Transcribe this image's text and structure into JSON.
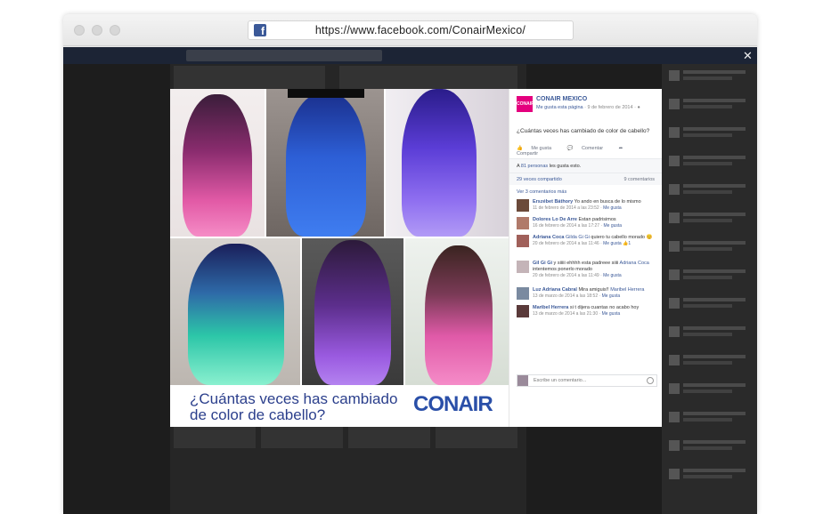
{
  "browser": {
    "url": "https://www.facebook.com/ConairMexico/",
    "favicon": "f"
  },
  "photo": {
    "caption_line1": "¿Cuántas veces has cambiado",
    "caption_line2": "de color de cabello?",
    "brand_logo": "CONAIR"
  },
  "post": {
    "page_avatar_text": "CONAIR",
    "page_name": "CONAIR MEXICO",
    "like_page": "Me gusta esta página",
    "date": " · 9 de febrero de 2014 · ",
    "text": "¿Cuántas veces has cambiado de color de cabello?",
    "action_like": "Me gusta",
    "action_comment": "Comentar",
    "action_share": "Compartir",
    "likes_prefix": "A ",
    "likes_count": "81 personas",
    "likes_suffix": " les gusta esto.",
    "shares": "29 veces compartido",
    "comments_count": "9 comentarios",
    "more_comments": "Ver 3 comentarios más",
    "write_placeholder": "Escribe un comentario..."
  },
  "comments": [
    {
      "author": "Erszébet Báthory",
      "text": " Yo ando en busca de lo mismo",
      "date": "11 de febrero de 2014 a las 23:52 · ",
      "like": "Me gusta"
    },
    {
      "author": "Dolores Lo De Arre",
      "text": " Estan padrisimos",
      "date": "16 de febrero de 2014 a las 17:27 · ",
      "like": "Me gusta"
    },
    {
      "author": "Adriana Coca",
      "mention": " Gilda Gi Gi",
      "text": " quiero tu cabello morado 😊",
      "date": "20 de febrero de 2014 a las 11:46 · ",
      "like": "Me gusta",
      "like_count": "1"
    },
    {
      "author": "Gil Gi Gi",
      "text": " y siiiii ehhhh esta padreee siiii ",
      "mention": "Adriana Coca",
      "text2": " intentemos ponerlo morado",
      "date": "20 de febrero de 2014 a las 11:49 · ",
      "like": "Me gusta"
    },
    {
      "author": "Luz Adriana Cabral",
      "text": " Mira amiguis!! ",
      "mention": "Maribel Herrera",
      "date": "13 de marzo de 2014 a las 18:52 · ",
      "like": "Me gusta"
    },
    {
      "author": "Maribel Herrera",
      "text": " si t dijera cuantas no acabo hoy",
      "date": "13 de marzo de 2014 a las 21:30 · ",
      "like": "Me gusta"
    }
  ],
  "colors": {
    "facebook_blue": "#3b5998",
    "conair_magenta": "#e4007e",
    "caption_blue": "#2b3f8c"
  },
  "icons": [
    "facebook-favicon-icon",
    "close-icon",
    "like-icon",
    "comment-icon",
    "share-icon",
    "camera-icon"
  ]
}
